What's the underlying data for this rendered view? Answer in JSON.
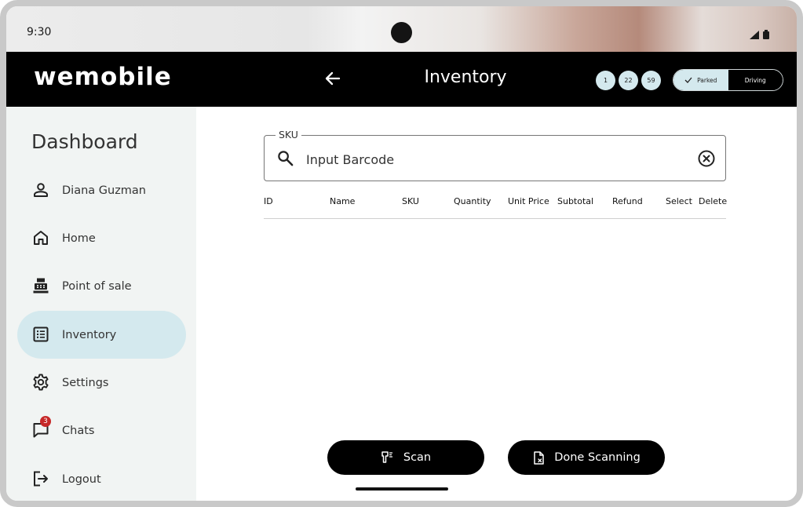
{
  "status_bar": {
    "time": "9:30"
  },
  "header": {
    "logo": "wemobile",
    "title": "Inventory",
    "counters": [
      "1",
      "22",
      "59"
    ],
    "mode_toggle": {
      "options": [
        "Parked",
        "Driving"
      ],
      "selected": "Parked"
    }
  },
  "sidebar": {
    "title": "Dashboard",
    "items": [
      {
        "label": "Diana Guzman",
        "icon": "person-icon"
      },
      {
        "label": "Home",
        "icon": "home-icon"
      },
      {
        "label": "Point of sale",
        "icon": "cash-register-icon"
      },
      {
        "label": "Inventory",
        "icon": "list-icon",
        "active": true
      },
      {
        "label": "Settings",
        "icon": "gear-icon"
      },
      {
        "label": "Chats",
        "icon": "chat-icon",
        "badge": "3"
      },
      {
        "label": "Logout",
        "icon": "logout-icon"
      }
    ]
  },
  "sku_field": {
    "label": "SKU",
    "placeholder": "Input Barcode",
    "value": ""
  },
  "table": {
    "columns": [
      "ID",
      "Name",
      "SKU",
      "Quantity",
      "Unit Price",
      "Subtotal",
      "Refund",
      "Select",
      "Delete"
    ],
    "rows": []
  },
  "actions": {
    "scan_label": "Scan",
    "done_label": "Done Scanning"
  },
  "colors": {
    "accent": "#d4e9ee",
    "header_bg": "#000000",
    "sidebar_bg": "#f1f4f3",
    "badge": "#c62828"
  }
}
